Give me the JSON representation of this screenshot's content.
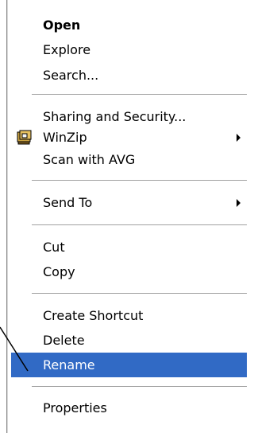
{
  "menu": {
    "items": [
      {
        "label": "Open",
        "bold": true
      },
      {
        "label": "Explore"
      },
      {
        "label": "Search..."
      },
      {
        "label": "Sharing and Security..."
      },
      {
        "label": "WinZip",
        "submenu": true,
        "icon": "winzip-icon"
      },
      {
        "label": "Scan with AVG"
      },
      {
        "label": "Send To",
        "submenu": true
      },
      {
        "label": "Cut"
      },
      {
        "label": "Copy"
      },
      {
        "label": "Create Shortcut"
      },
      {
        "label": "Delete"
      },
      {
        "label": "Rename",
        "selected": true
      },
      {
        "label": "Properties"
      }
    ]
  },
  "colors": {
    "selection": "#316ac5",
    "separator": "#a0a0a0"
  }
}
